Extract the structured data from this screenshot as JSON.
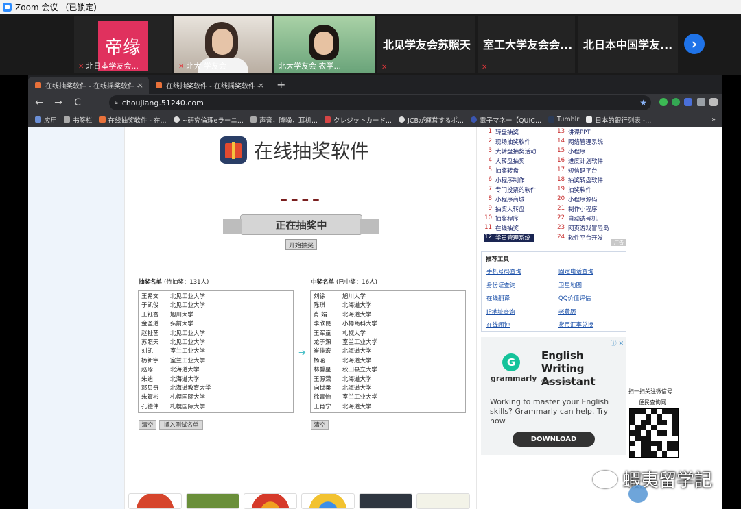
{
  "window": {
    "title": "Zoom 会议 （已锁定）"
  },
  "participants": [
    {
      "name": "北日本学友会...",
      "avatar_text": "帝缘",
      "avatar_color": "#e0315e"
    },
    {
      "name": "北大 学友会"
    },
    {
      "name": "北大学友会 农学..."
    },
    {
      "name": "北见学友会苏照天"
    },
    {
      "name": "室工大学友会会..."
    },
    {
      "name": "北日本中国学友..."
    }
  ],
  "participants_next": "›",
  "browser": {
    "tabs": [
      {
        "label": "在线抽奖软件 - 在线摇奖软件 - "
      },
      {
        "label": "在线抽奖软件 - 在线摇奖软件 - "
      }
    ],
    "tab_close": "×",
    "new_tab": "+",
    "nav_back": "←",
    "nav_forward": "→",
    "nav_reload": "C",
    "url": "choujiang.51240.com",
    "bookmarks": [
      "应用",
      "书签栏",
      "在线抽奖软件 - 在...",
      "~研究倫理eラーニ...",
      "声音，降噪，耳机...",
      "クレジットカード...",
      "JCBが運営するポ...",
      "電子マネー【QUIC...",
      "Tumblr",
      "日本的銀行列表 -..."
    ],
    "bookmarks_more": "»"
  },
  "site": {
    "title": "在线抽奖软件",
    "rolling_placeholder": "----",
    "drawing_banner": "正在抽奖中",
    "start_button": "开始抽奖",
    "pending": {
      "label": "抽奖名单",
      "count": "(待抽奖：131人)",
      "people": [
        [
          "王希文",
          "北见工业大学"
        ],
        [
          "于凯俊",
          "北见工业大学"
        ],
        [
          "王钰杏",
          "旭川大学"
        ],
        [
          "金圣道",
          "弘前大学"
        ],
        [
          "赵祉茜",
          "北见工业大学"
        ],
        [
          "苏照天",
          "北见工业大学"
        ],
        [
          "刘凯",
          "室兰工业大学"
        ],
        [
          "杨新宇",
          "室兰工业大学"
        ],
        [
          "赵琢",
          "北海道大学"
        ],
        [
          "朱迪",
          "北海道大学"
        ],
        [
          "邓贝奇",
          "北海道教育大学"
        ],
        [
          "朱賀彬",
          "札幌国际大学"
        ],
        [
          "孔德伟",
          "札幌国际大学"
        ]
      ]
    },
    "winners": {
      "label": "中奖名单",
      "count": "(已中奖：16人)",
      "people": [
        [
          "刘徐",
          "旭川大学"
        ],
        [
          "陈琪",
          "北海道大学"
        ],
        [
          "肖 娟",
          "北海道大学"
        ],
        [
          "李欣昆",
          "小樽商科大学"
        ],
        [
          "王军童",
          "札幌大学"
        ],
        [
          "龙子源",
          "室兰工业大学"
        ],
        [
          "崔佳宏",
          "北海道大学"
        ],
        [
          "杨涵",
          "北海道大学"
        ],
        [
          "林馨星",
          "秋田县立大学"
        ],
        [
          "王源潇",
          "北海道大学"
        ],
        [
          "向世柔",
          "北海道大学"
        ],
        [
          "徐青怡",
          "室兰工业大学"
        ],
        [
          "王肖宁",
          "北海道大学"
        ]
      ]
    },
    "transfer_arrow": "➔",
    "clear_button": "清空",
    "insert_test_button": "插入测试名单",
    "clear_winners_button": "清空"
  },
  "sidebar": {
    "links": [
      {
        "num": "1",
        "label": "转盘抽奖"
      },
      {
        "num": "2",
        "label": "现场抽奖软件"
      },
      {
        "num": "3",
        "label": "大转盘抽奖活动"
      },
      {
        "num": "4",
        "label": "大转盘抽奖"
      },
      {
        "num": "5",
        "label": "抽奖转盘"
      },
      {
        "num": "6",
        "label": "小程序制作"
      },
      {
        "num": "7",
        "label": "专门投票的软件"
      },
      {
        "num": "8",
        "label": "小程序商城"
      },
      {
        "num": "9",
        "label": "抽奖大转盘"
      },
      {
        "num": "10",
        "label": "抽奖程序"
      },
      {
        "num": "11",
        "label": "在线抽奖"
      },
      {
        "num": "12",
        "label": "学员管理系统"
      },
      {
        "num": "13",
        "label": "讲课PPT"
      },
      {
        "num": "14",
        "label": "网络管理系统"
      },
      {
        "num": "15",
        "label": "小程序"
      },
      {
        "num": "16",
        "label": "进度计划软件"
      },
      {
        "num": "17",
        "label": "短信码平台"
      },
      {
        "num": "18",
        "label": "抽奖转盘软件"
      },
      {
        "num": "19",
        "label": "抽奖软件"
      },
      {
        "num": "20",
        "label": "小程序源码"
      },
      {
        "num": "21",
        "label": "制作小程序"
      },
      {
        "num": "22",
        "label": "自动选号机"
      },
      {
        "num": "23",
        "label": "网页游戏冒险岛"
      },
      {
        "num": "24",
        "label": "软件平台开发"
      }
    ],
    "ad_tag": "广告",
    "tools_title": "推荐工具",
    "tools": [
      "手机号码查询",
      "固定电话查询",
      "身份证查询",
      "卫星地图",
      "在线翻译",
      "QQ价值评估",
      "IP地址查询",
      "老黄历",
      "在线闹钟",
      "货币汇率兑换"
    ],
    "ad": {
      "brand": "grammarly",
      "brand_letter": "G",
      "headline": "English Writing Assistant",
      "advertiser": "Grammarly",
      "body": "Working to master your English skills? Grammarly can help. Try now",
      "cta": "DOWNLOAD",
      "adchoice": "ⓘ ✕"
    },
    "qr": {
      "line1": "扫一扫关注微信号",
      "line2": "便民查询网"
    }
  },
  "watermark": "蝦夷留学記"
}
